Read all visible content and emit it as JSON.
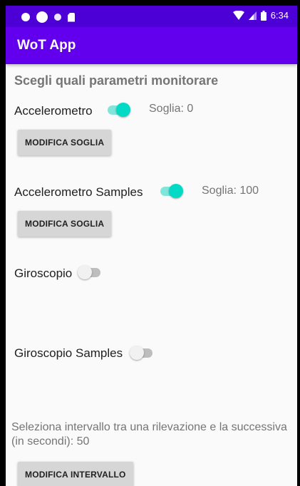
{
  "status_bar": {
    "time": "6:34",
    "background": "#4c00d6",
    "icons": [
      "settings-notification-icon",
      "circle-notification-icon",
      "small-circle-notification-icon",
      "sd-card-icon",
      "wifi-icon",
      "signal-icon",
      "battery-icon"
    ]
  },
  "app_bar": {
    "title": "WoT App",
    "background": "#6200ee"
  },
  "main": {
    "section_title": "Scegli quali parametri monitorare",
    "sensors": [
      {
        "label": "Accelerometro",
        "enabled": true,
        "threshold": "Soglia: 0",
        "button": "MODIFICA SOGLIA"
      },
      {
        "label": "Accelerometro Samples",
        "enabled": true,
        "threshold": "Soglia: 100",
        "button": "MODIFICA SOGLIA"
      },
      {
        "label": "Giroscopio",
        "enabled": false
      },
      {
        "label": "Giroscopio Samples",
        "enabled": false
      }
    ],
    "interval_text": "Seleziona intervallo tra una rilevazione e la successiva (in secondi): 50",
    "interval_button": "MODIFICA INTERVALLO"
  },
  "colors": {
    "switch_on_thumb": "#03dac5",
    "switch_on_track": "#80e5db",
    "switch_off_thumb": "#f1f1f1",
    "switch_off_track": "#bdbdbd",
    "button_bg": "#d6d6d6"
  }
}
